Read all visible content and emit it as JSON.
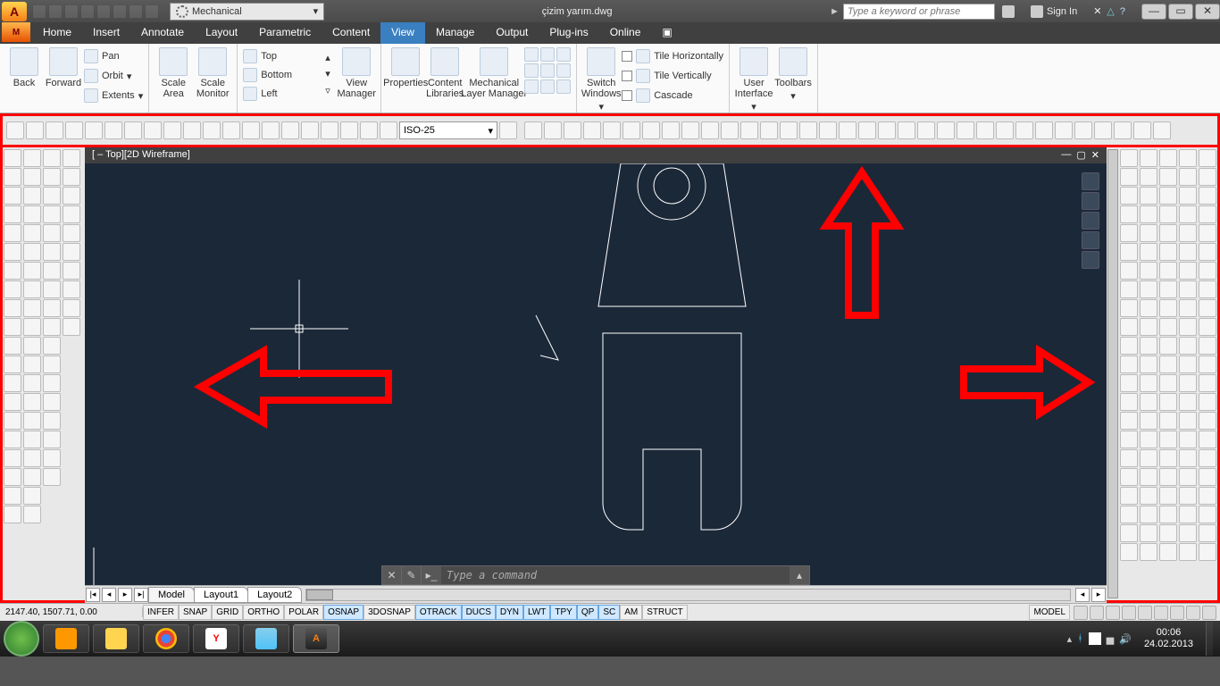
{
  "title": {
    "workspace": "Mechanical",
    "document": "çizim yarım.dwg",
    "search_placeholder": "Type a keyword or phrase",
    "signin": "Sign In"
  },
  "menu": {
    "items": [
      "Home",
      "Insert",
      "Annotate",
      "Layout",
      "Parametric",
      "Content",
      "View",
      "Manage",
      "Output",
      "Plug-ins",
      "Online"
    ],
    "active": "View"
  },
  "ribbon": {
    "nav": {
      "back": "Back",
      "forward": "Forward",
      "pan": "Pan",
      "orbit": "Orbit",
      "extents": "Extents"
    },
    "scale_area": "Scale\nArea",
    "scale_monitor": "Scale\nMonitor",
    "view_list": [
      "Top",
      "Bottom",
      "Left"
    ],
    "view_manager": "View\nManager",
    "properties": "Properties",
    "content_libraries": "Content\nLibraries",
    "layer_manager": "Mechanical\nLayer Manager",
    "switch_windows": "Switch\nWindows",
    "tile_h": "Tile Horizontally",
    "tile_v": "Tile Vertically",
    "cascade": "Cascade",
    "user_interface": "User\nInterface",
    "toolbars": "Toolbars"
  },
  "toolstrip": {
    "dim_style": "ISO-25"
  },
  "canvas": {
    "header": "[ – Top][2D Wireframe]"
  },
  "command": {
    "placeholder": "Type a command"
  },
  "layouts": {
    "tabs": [
      "Model",
      "Layout1",
      "Layout2"
    ],
    "active": "Model"
  },
  "status": {
    "coords": "2147.40, 1507.71, 0.00",
    "buttons": [
      "INFER",
      "SNAP",
      "GRID",
      "ORTHO",
      "POLAR",
      "OSNAP",
      "3DOSNAP",
      "OTRACK",
      "DUCS",
      "DYN",
      "LWT",
      "TPY",
      "QP",
      "SC",
      "AM",
      "STRUCT"
    ],
    "on": [
      "OSNAP",
      "OTRACK",
      "DUCS",
      "DYN",
      "LWT",
      "TPY",
      "QP",
      "SC"
    ],
    "model_label": "MODEL"
  },
  "taskbar": {
    "time": "00:06",
    "date": "24.02.2013"
  }
}
